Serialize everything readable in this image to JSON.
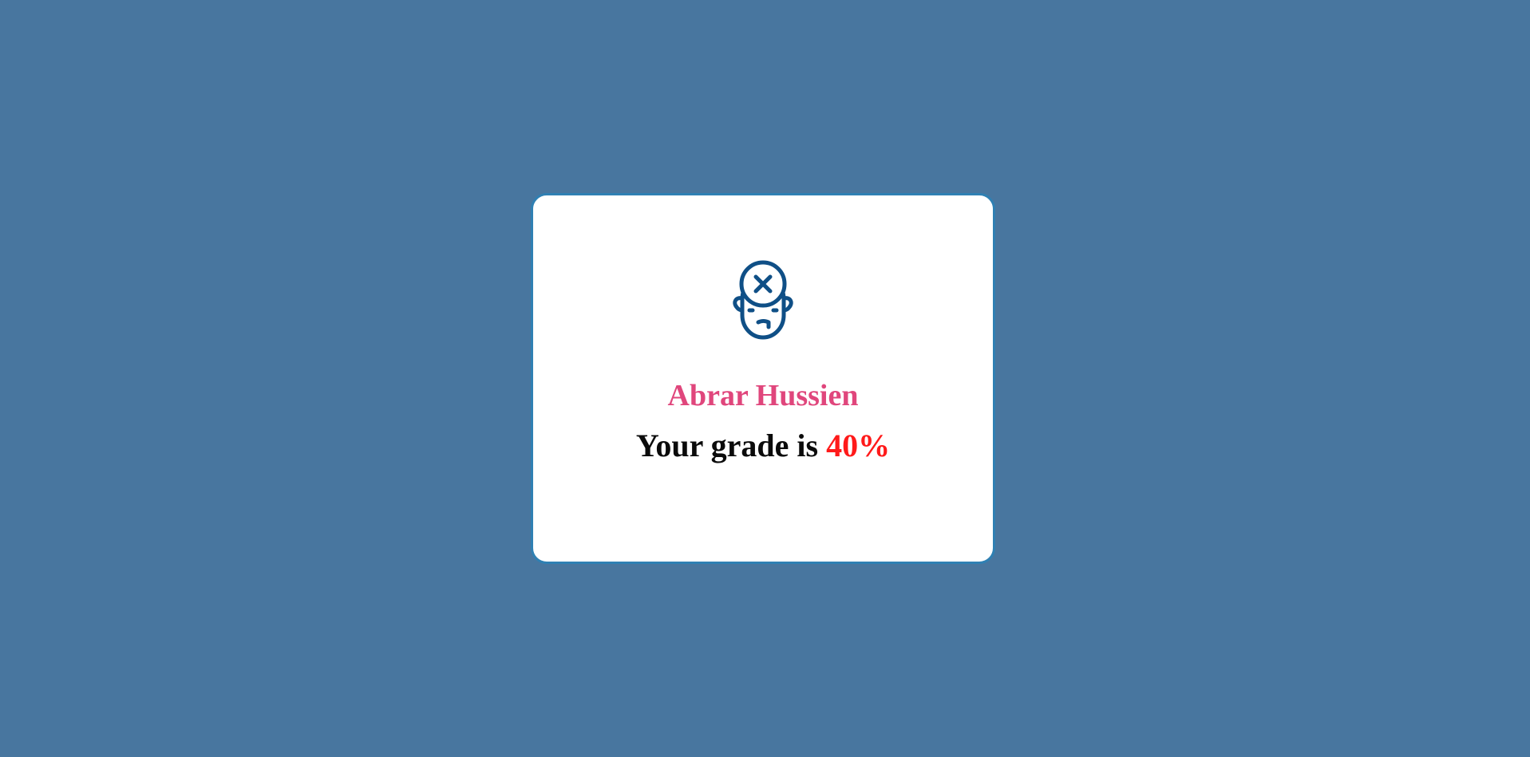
{
  "result": {
    "icon": "sad-face-with-x-icon",
    "student_name": "Abrar Hussien",
    "grade_prefix": "Your grade is",
    "grade_value": "40%"
  },
  "colors": {
    "background": "#48769f",
    "card_border": "#2f80b3",
    "name_color": "#e0467c",
    "grade_color": "#ff1a1a",
    "icon_color": "#0f4f86"
  }
}
